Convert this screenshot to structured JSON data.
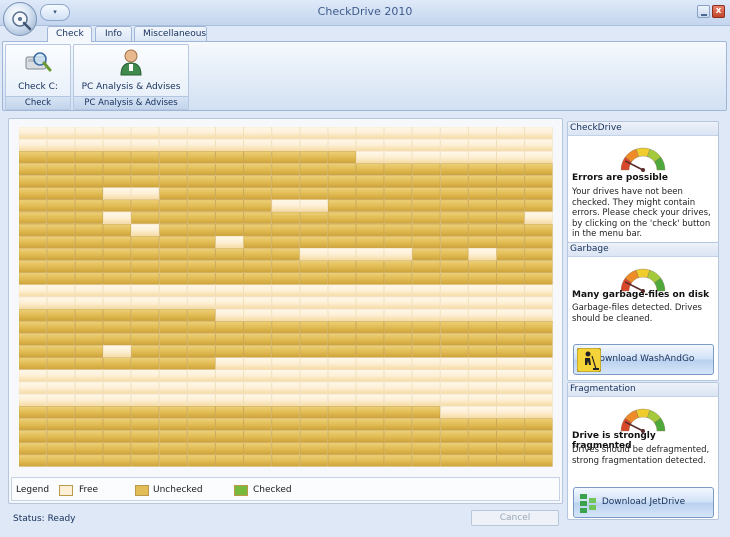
{
  "window": {
    "title": "CheckDrive 2010",
    "close_glyph": "x",
    "qat_glyph": "▾"
  },
  "ribbon": {
    "tabs": [
      "Check",
      "Info",
      "Miscellaneous"
    ],
    "groups": [
      {
        "button_label": "Check C:",
        "group_label": "Check",
        "icon": "drive-magnifier-icon"
      },
      {
        "button_label": "PC Analysis & Advises",
        "group_label": "PC Analysis & Advises",
        "icon": "user-advisor-icon"
      }
    ]
  },
  "cluster_map": {
    "rows": 28,
    "cols": 19,
    "counts": {
      "free": 58,
      "unchecked": 474,
      "checked": 0
    },
    "colors": {
      "free": "#fdf0d6",
      "unchecked": "#e2bd55",
      "checked": "#78b93b"
    },
    "free_cells": [
      [
        0,
        0
      ],
      [
        0,
        1
      ],
      [
        0,
        2
      ],
      [
        0,
        3
      ],
      [
        0,
        4
      ],
      [
        0,
        5
      ],
      [
        0,
        6
      ],
      [
        0,
        7
      ],
      [
        0,
        8
      ],
      [
        0,
        9
      ],
      [
        0,
        10
      ],
      [
        0,
        11
      ],
      [
        0,
        12
      ],
      [
        0,
        13
      ],
      [
        0,
        14
      ],
      [
        0,
        15
      ],
      [
        0,
        16
      ],
      [
        0,
        17
      ],
      [
        0,
        18
      ],
      [
        1,
        0
      ],
      [
        1,
        1
      ],
      [
        1,
        2
      ],
      [
        1,
        3
      ],
      [
        1,
        4
      ],
      [
        1,
        5
      ],
      [
        1,
        6
      ],
      [
        1,
        7
      ],
      [
        1,
        8
      ],
      [
        1,
        9
      ],
      [
        1,
        10
      ],
      [
        1,
        11
      ],
      [
        1,
        12
      ],
      [
        1,
        13
      ],
      [
        1,
        14
      ],
      [
        1,
        15
      ],
      [
        1,
        16
      ],
      [
        1,
        17
      ],
      [
        1,
        18
      ],
      [
        2,
        12
      ],
      [
        2,
        13
      ],
      [
        2,
        14
      ],
      [
        2,
        15
      ],
      [
        2,
        16
      ],
      [
        2,
        17
      ],
      [
        2,
        18
      ],
      [
        5,
        3
      ],
      [
        5,
        4
      ],
      [
        6,
        9
      ],
      [
        6,
        10
      ],
      [
        7,
        3
      ],
      [
        7,
        18
      ],
      [
        8,
        4
      ],
      [
        9,
        7
      ],
      [
        10,
        10
      ],
      [
        10,
        11
      ],
      [
        10,
        12
      ],
      [
        10,
        13
      ],
      [
        10,
        16
      ],
      [
        13,
        0
      ],
      [
        13,
        1
      ],
      [
        13,
        2
      ],
      [
        13,
        3
      ],
      [
        13,
        4
      ],
      [
        13,
        5
      ],
      [
        13,
        6
      ],
      [
        13,
        7
      ],
      [
        13,
        8
      ],
      [
        13,
        9
      ],
      [
        13,
        10
      ],
      [
        13,
        11
      ],
      [
        13,
        12
      ],
      [
        13,
        13
      ],
      [
        13,
        14
      ],
      [
        13,
        15
      ],
      [
        13,
        16
      ],
      [
        13,
        17
      ],
      [
        13,
        18
      ],
      [
        14,
        0
      ],
      [
        14,
        1
      ],
      [
        14,
        2
      ],
      [
        14,
        3
      ],
      [
        14,
        4
      ],
      [
        14,
        5
      ],
      [
        14,
        6
      ],
      [
        14,
        7
      ],
      [
        14,
        8
      ],
      [
        14,
        9
      ],
      [
        14,
        10
      ],
      [
        14,
        11
      ],
      [
        14,
        12
      ],
      [
        14,
        13
      ],
      [
        14,
        14
      ],
      [
        14,
        15
      ],
      [
        14,
        16
      ],
      [
        14,
        17
      ],
      [
        14,
        18
      ],
      [
        15,
        7
      ],
      [
        15,
        8
      ],
      [
        15,
        9
      ],
      [
        15,
        10
      ],
      [
        15,
        11
      ],
      [
        15,
        12
      ],
      [
        15,
        13
      ],
      [
        15,
        14
      ],
      [
        15,
        15
      ],
      [
        15,
        16
      ],
      [
        15,
        17
      ],
      [
        15,
        18
      ],
      [
        18,
        3
      ],
      [
        19,
        7
      ],
      [
        19,
        8
      ],
      [
        19,
        9
      ],
      [
        19,
        10
      ],
      [
        19,
        11
      ],
      [
        19,
        12
      ],
      [
        19,
        13
      ],
      [
        19,
        14
      ],
      [
        19,
        15
      ],
      [
        19,
        16
      ],
      [
        19,
        17
      ],
      [
        19,
        18
      ],
      [
        20,
        0
      ],
      [
        20,
        1
      ],
      [
        20,
        2
      ],
      [
        20,
        3
      ],
      [
        20,
        4
      ],
      [
        20,
        5
      ],
      [
        20,
        6
      ],
      [
        20,
        7
      ],
      [
        20,
        8
      ],
      [
        20,
        9
      ],
      [
        20,
        10
      ],
      [
        20,
        11
      ],
      [
        20,
        12
      ],
      [
        20,
        13
      ],
      [
        20,
        14
      ],
      [
        20,
        15
      ],
      [
        20,
        16
      ],
      [
        20,
        17
      ],
      [
        20,
        18
      ],
      [
        21,
        0
      ],
      [
        21,
        1
      ],
      [
        21,
        2
      ],
      [
        21,
        3
      ],
      [
        21,
        4
      ],
      [
        21,
        5
      ],
      [
        21,
        6
      ],
      [
        21,
        7
      ],
      [
        21,
        8
      ],
      [
        21,
        9
      ],
      [
        21,
        10
      ],
      [
        21,
        11
      ],
      [
        21,
        12
      ],
      [
        21,
        13
      ],
      [
        21,
        14
      ],
      [
        21,
        15
      ],
      [
        21,
        16
      ],
      [
        21,
        17
      ],
      [
        21,
        18
      ],
      [
        22,
        0
      ],
      [
        22,
        1
      ],
      [
        22,
        2
      ],
      [
        22,
        3
      ],
      [
        22,
        4
      ],
      [
        22,
        5
      ],
      [
        22,
        6
      ],
      [
        22,
        7
      ],
      [
        22,
        8
      ],
      [
        22,
        9
      ],
      [
        22,
        10
      ],
      [
        22,
        11
      ],
      [
        22,
        12
      ],
      [
        22,
        13
      ],
      [
        22,
        14
      ],
      [
        22,
        15
      ],
      [
        22,
        16
      ],
      [
        22,
        17
      ],
      [
        22,
        18
      ],
      [
        23,
        15
      ],
      [
        23,
        16
      ],
      [
        23,
        17
      ],
      [
        23,
        18
      ]
    ]
  },
  "legend": {
    "title": "Legend",
    "items": [
      {
        "label": "Free",
        "color": "#fdf0d6"
      },
      {
        "label": "Unchecked",
        "color": "#e2bd55"
      },
      {
        "label": "Checked",
        "color": "#78b93b"
      }
    ]
  },
  "sidebar": {
    "checkdrive": {
      "header": "CheckDrive",
      "title": "Errors are possible",
      "body": "Your drives have not been checked. They might contain errors. Please check your drives, by clicking on the 'check' button in the menu bar.",
      "gauge_level": 0.15
    },
    "garbage": {
      "header": "Garbage",
      "title": "Many garbage-files on disk",
      "body": "Garbage-files detected. Drives should be cleaned.",
      "button_label": "Download WashAndGo",
      "gauge_level": 0.15
    },
    "fragmentation": {
      "header": "Fragmentation",
      "title": "Drive is strongly fragmented",
      "body": "Drives should be defragmented, strong fragmentation detected.",
      "button_label": "Download JetDrive",
      "gauge_level": 0.15
    }
  },
  "status": {
    "text": "Status: Ready",
    "cancel_label": "Cancel"
  }
}
